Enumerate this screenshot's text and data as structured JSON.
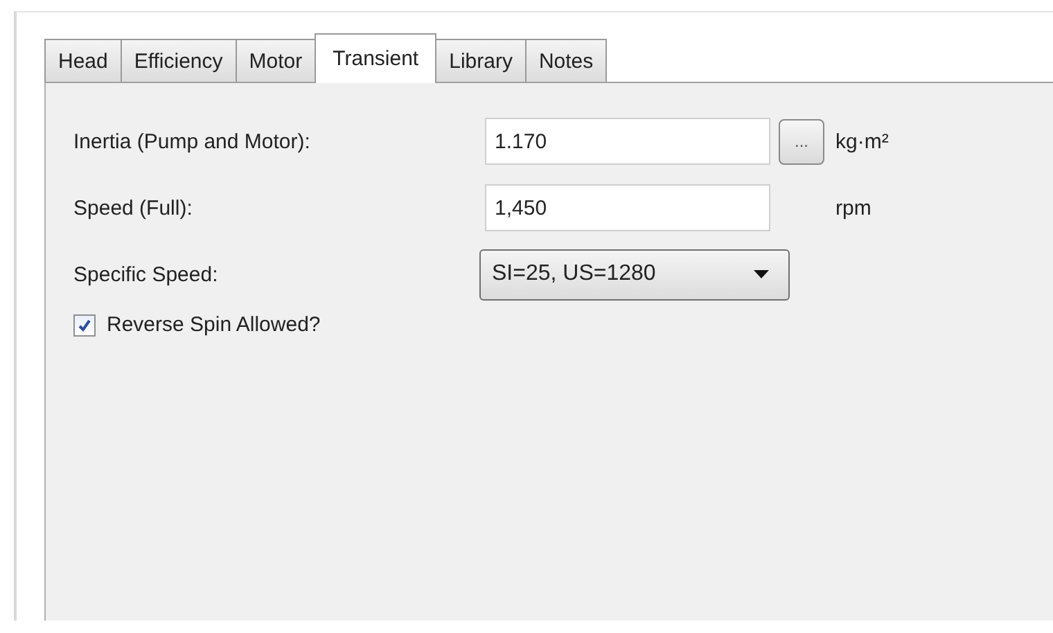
{
  "tabs": [
    {
      "label": "Head",
      "selected": false
    },
    {
      "label": "Efficiency",
      "selected": false
    },
    {
      "label": "Motor",
      "selected": false
    },
    {
      "label": "Transient",
      "selected": true
    },
    {
      "label": "Library",
      "selected": false
    },
    {
      "label": "Notes",
      "selected": false
    }
  ],
  "fields": [
    {
      "kind": "text",
      "label": "Inertia (Pump and Motor):",
      "value": "1.170",
      "button": "...",
      "unit": "kg·m²"
    },
    {
      "kind": "text",
      "label": "Speed (Full):",
      "value": "1,450",
      "unit": "rpm"
    },
    {
      "kind": "dropdown",
      "label": "Specific Speed:",
      "value": "SI=25, US=1280"
    }
  ],
  "checkbox": {
    "label": "Reverse Spin Allowed?",
    "checked": true
  }
}
